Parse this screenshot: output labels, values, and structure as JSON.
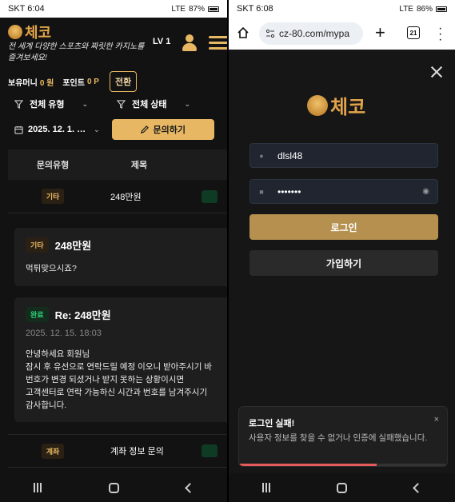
{
  "left": {
    "status_bar": {
      "carrier": "SKT",
      "time": "6:04",
      "signal": "LTE",
      "battery": "87%"
    },
    "header": {
      "logo_text": "체코",
      "tagline_prefix": "전 세계 다양한 스포츠와 짜릿한 카지노를 즐겨보세요!",
      "level": "LV 1"
    },
    "balance": {
      "money_label": "보유머니",
      "money_value": "0 원",
      "point_label": "포인트",
      "point_value": "0 P",
      "convert_label": "전환"
    },
    "filters": {
      "type_label": "전체 유형",
      "status_label": "전체 상태"
    },
    "date_range": "2025. 12. 1. …",
    "inquiry_button": "문의하기",
    "table": {
      "headers": [
        "문의유형",
        "제목"
      ],
      "rows": [
        {
          "type": "기타",
          "title": "248만원"
        },
        {
          "type": "계좌",
          "title": "계좌 정보 문의"
        }
      ]
    },
    "question_card": {
      "tag": "기타",
      "title": "248만원",
      "body": "먹튀맞으시죠?"
    },
    "answer_card": {
      "tag": "완료",
      "title": "Re: 248만원",
      "date": "2025. 12. 15. 18:03",
      "body_lines": [
        "안녕하세요 회원님",
        "잠시 후 유선으로 연락드릴 예정 이오니 받아주시기 바",
        "번호가 변경 되셨거나 받지 못하는 상황이시면",
        "고객센터로 연락 가능하신 시간과 번호를 남겨주시기",
        "감사합니다."
      ]
    }
  },
  "right": {
    "status_bar": {
      "carrier": "SKT",
      "time": "6:08",
      "signal": "LTE",
      "battery": "86%"
    },
    "browser": {
      "url": "cz-80.com/mypa",
      "tab_count": "21"
    },
    "login": {
      "logo_text": "체코",
      "username": "dlsl48",
      "password_mask": "•••••••",
      "login_button": "로그인",
      "join_button": "가입하기"
    },
    "toast": {
      "title": "로그인 실패!",
      "message": "사용자 정보를 찾을 수 없거나 인증에 실패했습니다.",
      "close": "×",
      "progress": 0.66
    }
  },
  "colors": {
    "gold": "#e8b763",
    "button_gold": "#b5904e",
    "toast_progress": "#e55a5a",
    "done_green": "#2fd07a"
  },
  "icons": [
    "funnel-icon",
    "calendar-icon",
    "pencil-icon",
    "user-icon",
    "menu-icon",
    "home-icon",
    "lock-icon",
    "person-icon",
    "eye-icon",
    "close-icon"
  ]
}
